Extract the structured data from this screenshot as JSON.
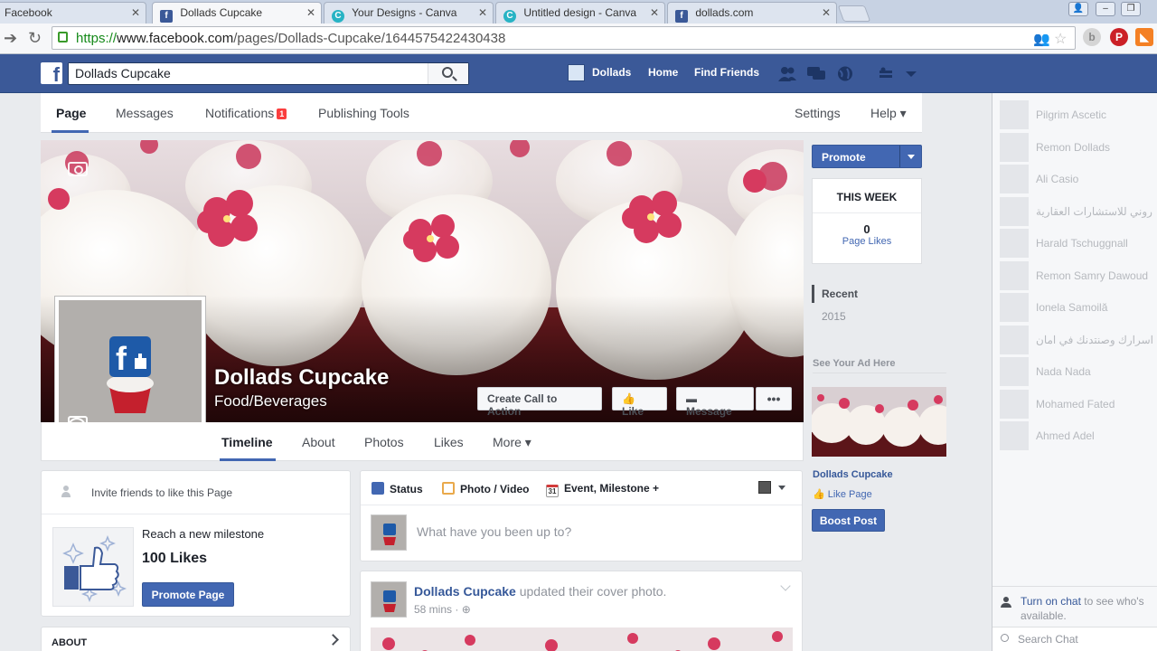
{
  "browser": {
    "tabs": [
      {
        "title": "Facebook",
        "favicon": "facebook-icon"
      },
      {
        "title": "Dollads Cupcake",
        "favicon": "facebook-icon",
        "active": true
      },
      {
        "title": "Your Designs - Canva",
        "favicon": "canva-icon"
      },
      {
        "title": "Untitled design - Canva",
        "favicon": "canva-icon"
      },
      {
        "title": "dollads.com",
        "favicon": "facebook-icon"
      }
    ],
    "url_scheme": "https://",
    "url_host": "www.facebook.com",
    "url_path": "/pages/Dollads-Cupcake/1644575422430438"
  },
  "fb_header": {
    "search_value": "Dollads Cupcake",
    "profile_name": "Dollads",
    "home": "Home",
    "find_friends": "Find Friends"
  },
  "page_nav": {
    "page": "Page",
    "messages": "Messages",
    "notifications": "Notifications",
    "notifications_count": "1",
    "publishing_tools": "Publishing Tools",
    "settings": "Settings",
    "help": "Help ▾"
  },
  "cover": {
    "page_name": "Dollads Cupcake",
    "category": "Food/Beverages",
    "cta_button": "Create Call to Action",
    "like_button": "Like",
    "message_button": "Message",
    "more_button": "•••"
  },
  "timeline_tabs": [
    "Timeline",
    "About",
    "Photos",
    "Likes",
    "More ▾"
  ],
  "right_column": {
    "promote": "Promote",
    "this_week": "THIS WEEK",
    "page_likes_count": "0",
    "page_likes_label": "Page Likes",
    "recent": "Recent",
    "year": "2015",
    "ad_heading": "See Your Ad Here",
    "ad_name": "Dollads Cupcake",
    "ad_like": "Like Page",
    "boost": "Boost Post"
  },
  "left_column": {
    "invite": "Invite friends to like this Page",
    "milestone_title": "Reach a new milestone",
    "milestone_count": "100 Likes",
    "promote_page": "Promote Page",
    "about": "ABOUT"
  },
  "composer": {
    "status": "Status",
    "photo_video": "Photo / Video",
    "event": "Event, Milestone +",
    "calendar_day": "31",
    "placeholder": "What have you been up to?"
  },
  "post": {
    "author": "Dollads Cupcake",
    "action": "updated their cover photo.",
    "time": "58 mins"
  },
  "chat": {
    "contacts": [
      "Pilgrim Ascetic",
      "Remon Dollads",
      "Ali Casio",
      "روني للاستشارات العقارية",
      "Harald Tschuggnall",
      "Remon Samry Dawoud",
      "Ionela Samoilă",
      "اسرارك وصنتدنك في امان",
      "Nada Nada",
      "Mohamed Fated",
      "Ahmed Adel"
    ],
    "turn_on_link": "Turn on chat",
    "turn_on_rest": " to see who's available.",
    "search_placeholder": "Search Chat"
  },
  "colors": {
    "fb_blue": "#3b5998",
    "button_blue": "#4267b2",
    "link_blue": "#365899",
    "notification_red": "#fa3e3e"
  }
}
